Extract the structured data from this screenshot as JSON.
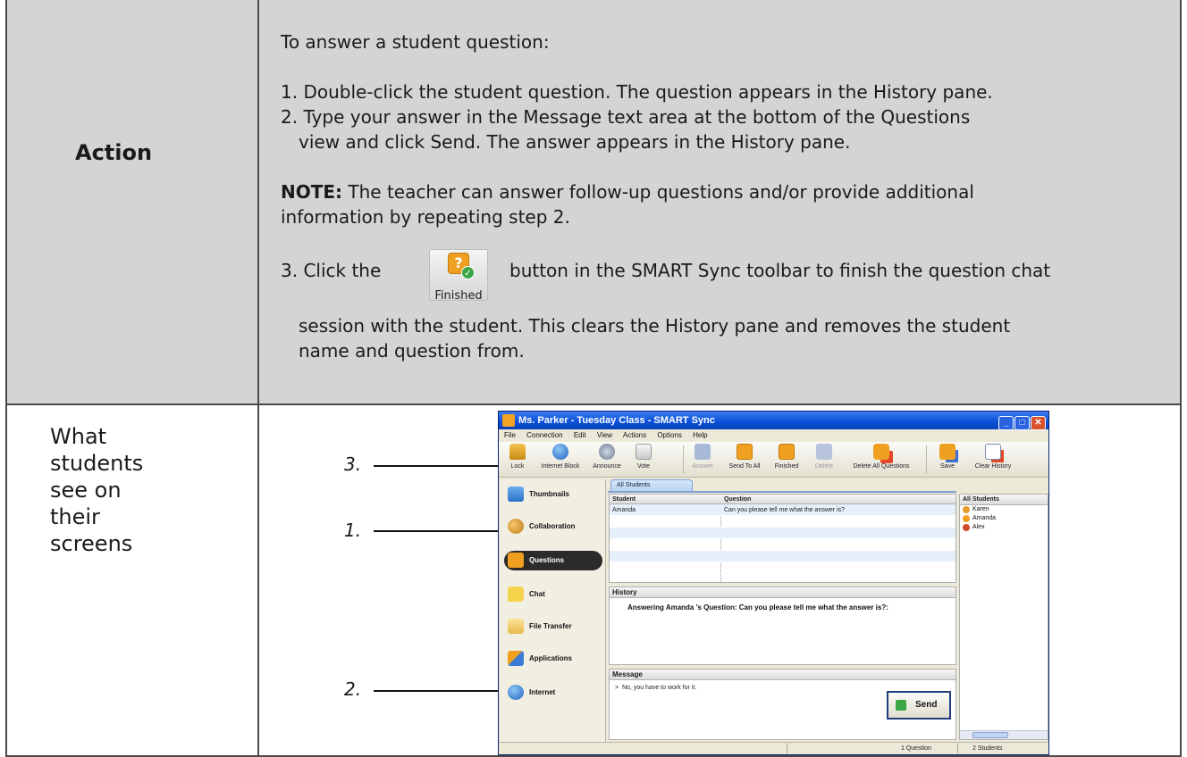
{
  "action_row": {
    "label": "Action",
    "heading": "To answer a student question:",
    "step1": "1. Double-click the student question. The question appears in the History pane.",
    "step2_a": "2. Type your answer in the Message text area at the bottom of the Questions",
    "step2_b_pre": "view and click ",
    "step2_b_bold": "Send",
    "step2_b_post": ". The answer appears in the History pane.",
    "note_label": "NOTE:",
    "note_a": " The teacher can answer follow-up questions and/or provide additional",
    "note_b": "information by repeating step 2.",
    "step3_pre": "3. Click the",
    "step3_button_label": "Finished",
    "step3_post": "button in the SMART Sync toolbar to finish the question chat",
    "step3_cont_a": "session with the student. This clears the History pane and removes the student",
    "step3_cont_b": "name and question from."
  },
  "students_row": {
    "label_lines": [
      "What",
      "students",
      "see on",
      "their",
      "screens"
    ]
  },
  "callouts": {
    "one": "1.",
    "two": "2.",
    "three": "3."
  },
  "window": {
    "title": "Ms.  Parker - Tuesday Class - SMART Sync",
    "menu": [
      "File",
      "Connection",
      "Edit",
      "View",
      "Actions",
      "Options",
      "Help"
    ],
    "toolbar": {
      "lock": "Lock",
      "internet_block": "Internet Block",
      "announce": "Announce",
      "vote": "Vote",
      "answer": "Answer",
      "send_to_all": "Send To All",
      "finished": "Finished",
      "delete": "Delete",
      "delete_all": "Delete All Questions",
      "save": "Save",
      "clear_history": "Clear History"
    },
    "sidebar": {
      "thumbnails": "Thumbnails",
      "collaboration": "Collaboration",
      "questions": "Questions",
      "chat": "Chat",
      "file_transfer": "File Transfer",
      "applications": "Applications",
      "internet": "Internet"
    },
    "tab": "All Students",
    "questions_table": {
      "col_student": "Student",
      "col_question": "Question",
      "rows": [
        {
          "student": "Amanda",
          "question": "Can you please tell me what the answer is?"
        }
      ]
    },
    "history": {
      "header": "History",
      "text": "Answering Amanda  's Question: Can you please tell me what the answer is?:"
    },
    "message": {
      "header": "Message",
      "prompt": ">",
      "text": "No, you have to work for it.",
      "send": "Send"
    },
    "students_panel": {
      "header": "All Students",
      "items": [
        "Karen",
        "Amanda",
        "Alex"
      ],
      "item_colors": [
        "#e89a2a",
        "#f0a020",
        "#d24a2a"
      ]
    },
    "status": {
      "questions": "1 Question",
      "students": "2 Students"
    }
  }
}
